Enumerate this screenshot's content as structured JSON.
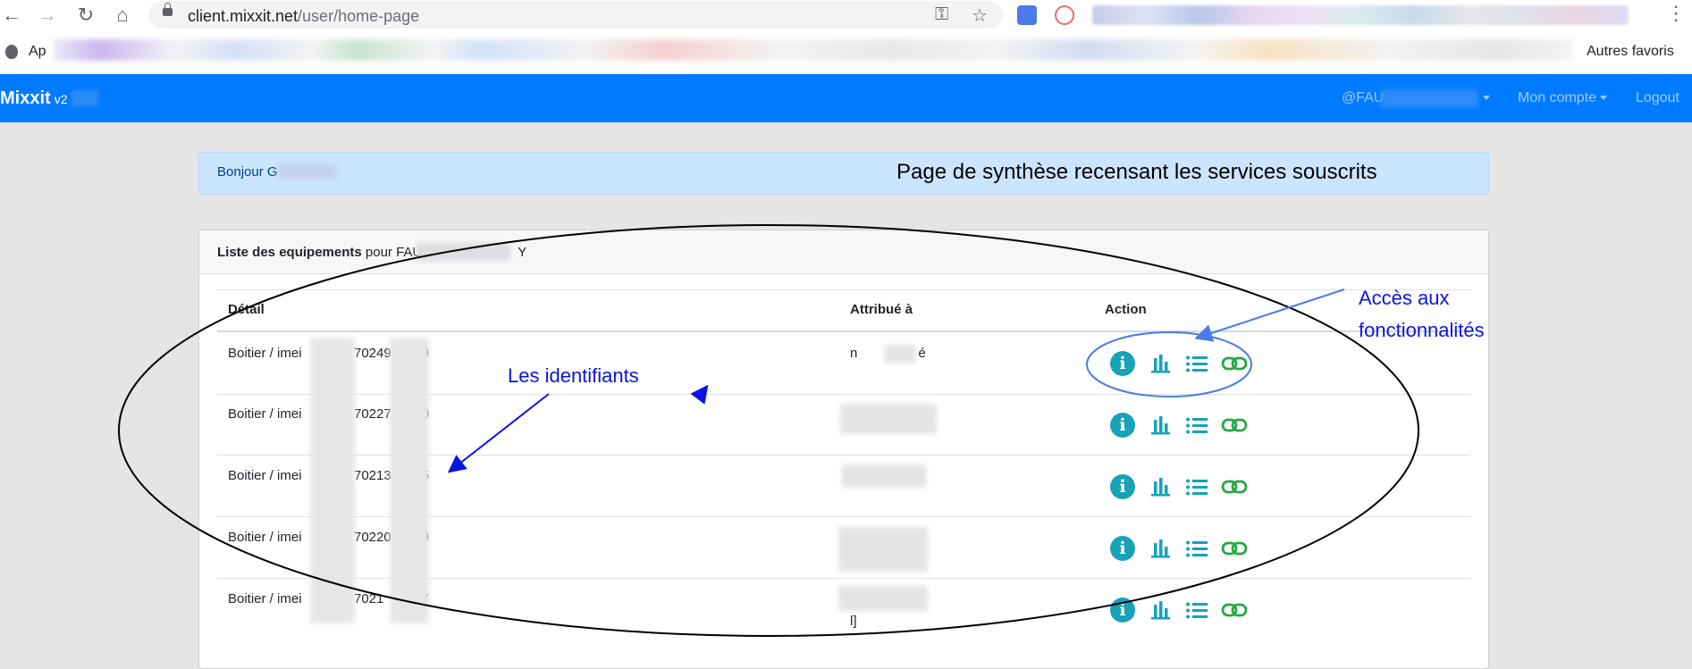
{
  "browser": {
    "url_host": "client.mixxit.net",
    "url_path": "/user/home-page",
    "bookmark_apps_label": "Ap",
    "bookmark_other": "Autres favoris"
  },
  "navbar": {
    "brand": "Mixxit",
    "version": "v2",
    "account_dropdown": "@FAU",
    "mon_compte": "Mon compte",
    "logout": "Logout"
  },
  "greeting": {
    "text": "Bonjour G"
  },
  "annotations": {
    "page_title": "Page de synthèse recensant les services souscrits",
    "identifiers": "Les identifiants",
    "features_line1": "Accès aux",
    "features_line2": "fonctionnalités"
  },
  "equipment": {
    "card_title": "Liste des equipements",
    "card_title_suffix": "pour FAU",
    "card_title_end": "Y",
    "columns": [
      "Détail",
      "Attribué à",
      "Action"
    ],
    "rows": [
      {
        "type": "Boitier / imei",
        "number": "70249",
        "number_end": "9",
        "assigned": "n",
        "assigned_end": "é"
      },
      {
        "type": "Boitier / imei",
        "number": "70227",
        "number_end": "0",
        "assigned": "",
        "assigned_end": ""
      },
      {
        "type": "Boitier / imei",
        "number": "70213",
        "number_end": "5",
        "assigned": "",
        "assigned_end": ""
      },
      {
        "type": "Boitier / imei",
        "number": "70220",
        "number_end": "9",
        "assigned": "",
        "assigned_end": ""
      },
      {
        "type": "Boitier / imei",
        "number": "7021",
        "number_end": "7",
        "assigned": "",
        "assigned_end": "l]"
      }
    ],
    "action_icons": [
      "info-icon",
      "chart-icon",
      "list-icon",
      "link-icon"
    ]
  },
  "colors": {
    "navbar": "#007bff",
    "alert_bg": "#cce5ff",
    "info": "#17a2b8",
    "link": "#28a745",
    "annotation": "#0a14e0"
  }
}
